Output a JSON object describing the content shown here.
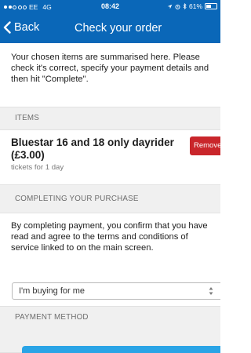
{
  "status_bar": {
    "carrier": "EE",
    "network": "4G",
    "time": "08:42",
    "battery": "61%",
    "battery_level": 0.61
  },
  "nav": {
    "back_label": "Back",
    "title": "Check your order"
  },
  "intro": {
    "text": "Your chosen items are summarised here. Please check it's correct, specify your payment details and then hit \"Complete\"."
  },
  "items_section": {
    "header": "ITEMS",
    "items": [
      {
        "name": "Bluestar 16 and 18 only dayrider (£3.00)",
        "subtitle": "tickets for 1 day",
        "remove_label": "Remove"
      }
    ]
  },
  "completing_section": {
    "header": "COMPLETING YOUR PURCHASE",
    "text": "By completing payment, you confirm that you have read and agree to the terms and conditions of service linked to on the main screen."
  },
  "buyer_select": {
    "value": "I'm buying for me"
  },
  "payment_section": {
    "header": "PAYMENT METHOD"
  },
  "colors": {
    "nav_blue": "#0a67b8",
    "remove_red": "#c9262b",
    "pay_blue": "#2aa4e6"
  }
}
